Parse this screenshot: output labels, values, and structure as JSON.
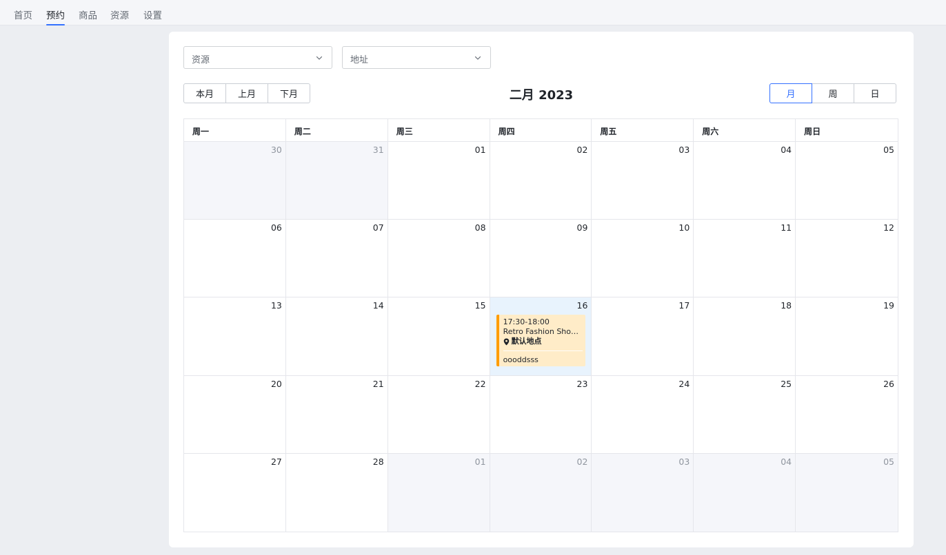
{
  "nav": {
    "tabs": [
      {
        "label": "首页"
      },
      {
        "label": "预约"
      },
      {
        "label": "商品"
      },
      {
        "label": "资源"
      },
      {
        "label": "设置"
      }
    ],
    "active_index": 1
  },
  "filters": {
    "resource_placeholder": "资源",
    "address_placeholder": "地址"
  },
  "toolbar": {
    "this_month": "本月",
    "prev_month": "上月",
    "next_month": "下月",
    "title": "二月 2023",
    "view_month": "月",
    "view_week": "周",
    "view_day": "日",
    "active_view": "month"
  },
  "calendar": {
    "weekdays": [
      "周一",
      "周二",
      "周三",
      "周四",
      "周五",
      "周六",
      "周日"
    ],
    "days": [
      {
        "num": "30",
        "other": true
      },
      {
        "num": "31",
        "other": true
      },
      {
        "num": "01"
      },
      {
        "num": "02"
      },
      {
        "num": "03"
      },
      {
        "num": "04"
      },
      {
        "num": "05"
      },
      {
        "num": "06"
      },
      {
        "num": "07"
      },
      {
        "num": "08"
      },
      {
        "num": "09"
      },
      {
        "num": "10"
      },
      {
        "num": "11"
      },
      {
        "num": "12"
      },
      {
        "num": "13"
      },
      {
        "num": "14"
      },
      {
        "num": "15"
      },
      {
        "num": "16",
        "today": true
      },
      {
        "num": "17"
      },
      {
        "num": "18"
      },
      {
        "num": "19"
      },
      {
        "num": "20"
      },
      {
        "num": "21"
      },
      {
        "num": "22"
      },
      {
        "num": "23"
      },
      {
        "num": "24"
      },
      {
        "num": "25"
      },
      {
        "num": "26"
      },
      {
        "num": "27"
      },
      {
        "num": "28"
      },
      {
        "num": "01",
        "other": true
      },
      {
        "num": "02",
        "other": true
      },
      {
        "num": "03",
        "other": true
      },
      {
        "num": "04",
        "other": true
      },
      {
        "num": "05",
        "other": true
      }
    ],
    "event": {
      "time": "17:30-18:00",
      "title": "Retro Fashion Shoulder Bag",
      "location": "默认地点",
      "note": "oooddsss",
      "accent_color": "#ff9d00",
      "bg_color": "#ffecc8"
    }
  },
  "colors": {
    "primary": "#3370ff",
    "today_bg": "#e8f3fd",
    "other_month_bg": "#f5f6fa"
  }
}
